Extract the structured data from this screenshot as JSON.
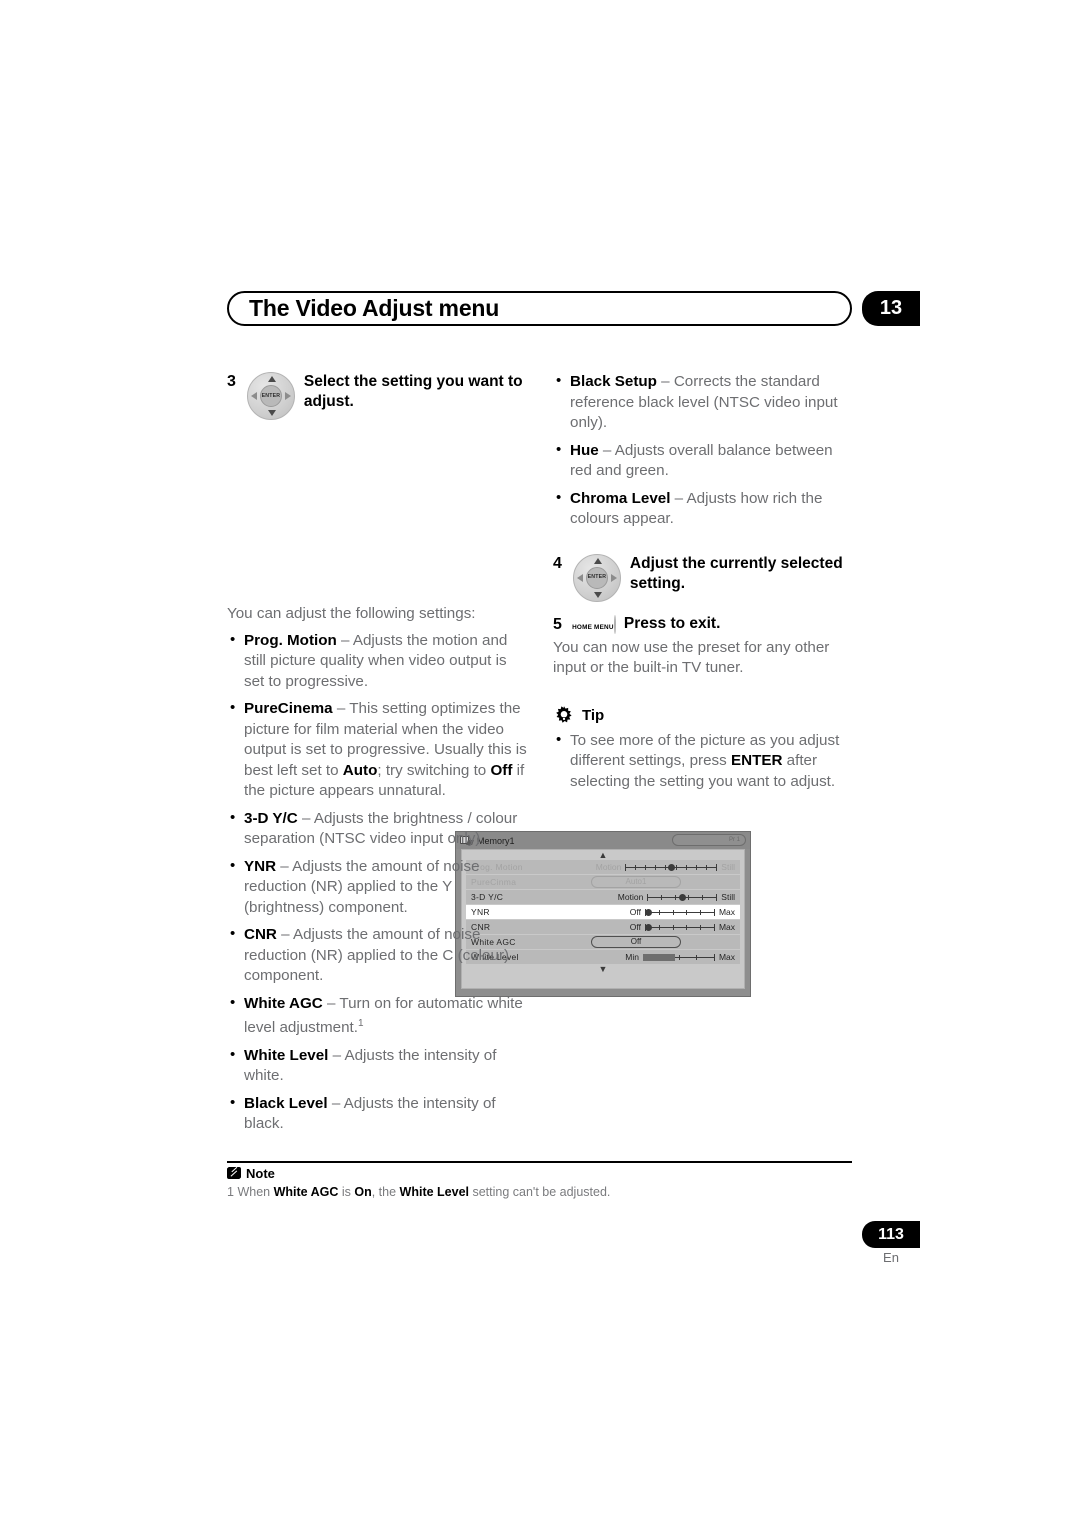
{
  "header": {
    "title": "The Video Adjust menu",
    "chapter": "13"
  },
  "steps": {
    "step3": {
      "num": "3",
      "icon": "dpad-enter-icon",
      "enter_label": "ENTER",
      "text": "Select the setting you want to adjust."
    },
    "step4": {
      "num": "4",
      "icon": "dpad-enter-icon",
      "enter_label": "ENTER",
      "text": "Adjust the currently selected setting."
    },
    "step5": {
      "num": "5",
      "button_label": "HOME MENU",
      "text": "Press to exit.",
      "after": "You can now use the preset for any other input or the built-in TV tuner."
    }
  },
  "osd": {
    "title": "Memory1",
    "tag": "Pr 1",
    "up_caret": "▲",
    "down_caret": "▼",
    "rows": [
      {
        "label": "Prog. Motion",
        "left": "Motion",
        "right": "Still",
        "type": "scale",
        "value": 50,
        "state": "dim",
        "ticks": 9
      },
      {
        "label": "PureCinma",
        "value_text": "Auto1",
        "type": "pill",
        "state": "dim"
      },
      {
        "label": "3-D  Y/C",
        "left": "Motion",
        "right": "Still",
        "type": "scale",
        "value": 50,
        "state": "normal",
        "ticks": 5
      },
      {
        "label": "YNR",
        "left": "Off",
        "right": "Max",
        "type": "scale",
        "value": 0,
        "state": "selected",
        "ticks": 5
      },
      {
        "label": "CNR",
        "left": "Off",
        "right": "Max",
        "type": "scale",
        "value": 0,
        "state": "normal",
        "ticks": 5
      },
      {
        "label": "White  AGC",
        "value_text": "Off",
        "type": "pill",
        "state": "normal"
      },
      {
        "label": "White  Level",
        "left": "Min",
        "right": "Max",
        "type": "fill",
        "value": 45,
        "state": "normal",
        "ticks": 4
      }
    ]
  },
  "left_column": {
    "intro": "You can adjust the following settings:",
    "bullets": [
      {
        "term": "Prog. Motion",
        "dash": " – ",
        "desc": "Adjusts the motion and still picture quality when video output is set to progressive."
      },
      {
        "term": "PureCinema",
        "dash": " –  ",
        "desc": "This setting optimizes the picture for film material when the video output is set to progressive. Usually this is best left set to ",
        "desc2": "Auto",
        "desc3": "; try switching to ",
        "desc4": "Off",
        "desc5": " if the picture appears unnatural."
      },
      {
        "term": "3-D Y/C",
        "dash": " – ",
        "desc": "Adjusts the brightness / colour separation (NTSC video input only)."
      },
      {
        "term": "YNR",
        "dash": " – ",
        "desc": "Adjusts the amount of noise reduction (NR) applied to the Y (brightness) component."
      },
      {
        "term": "CNR",
        "dash": " – ",
        "desc": "Adjusts the amount of noise reduction (NR) applied to the C (colour) component."
      },
      {
        "term": "White AGC",
        "dash": " – ",
        "desc": "Turn on for automatic white level adjustment.",
        "footnote": "1"
      },
      {
        "term": "White Level",
        "dash": " – ",
        "desc": "Adjusts the intensity of white."
      },
      {
        "term": "Black Level",
        "dash": " – ",
        "desc": "Adjusts the intensity of black."
      }
    ]
  },
  "right_column": {
    "bullets": [
      {
        "term": "Black Setup",
        "dash": " – ",
        "desc": "Corrects the standard reference black level (NTSC video input only)."
      },
      {
        "term": "Hue",
        "dash": " – ",
        "desc": "Adjusts overall balance between red and green."
      },
      {
        "term": "Chroma Level",
        "dash": " – ",
        "desc": "Adjusts how rich the colours appear."
      }
    ]
  },
  "tip": {
    "icon": "tip-bulb-icon",
    "label": "Tip",
    "bullet_pre": "To see more of the picture as you adjust different settings, press ",
    "bullet_bold": "ENTER",
    "bullet_post": " after selecting the setting you want to adjust."
  },
  "note": {
    "icon": "note-pencil-icon",
    "label": "Note",
    "num": "1",
    "pre": "When ",
    "b1": "White AGC",
    "mid1": " is ",
    "b2": "On",
    "mid2": ", the ",
    "b3": "White Level",
    "post": " setting can't be adjusted."
  },
  "footer": {
    "page": "113",
    "lang": "En"
  }
}
